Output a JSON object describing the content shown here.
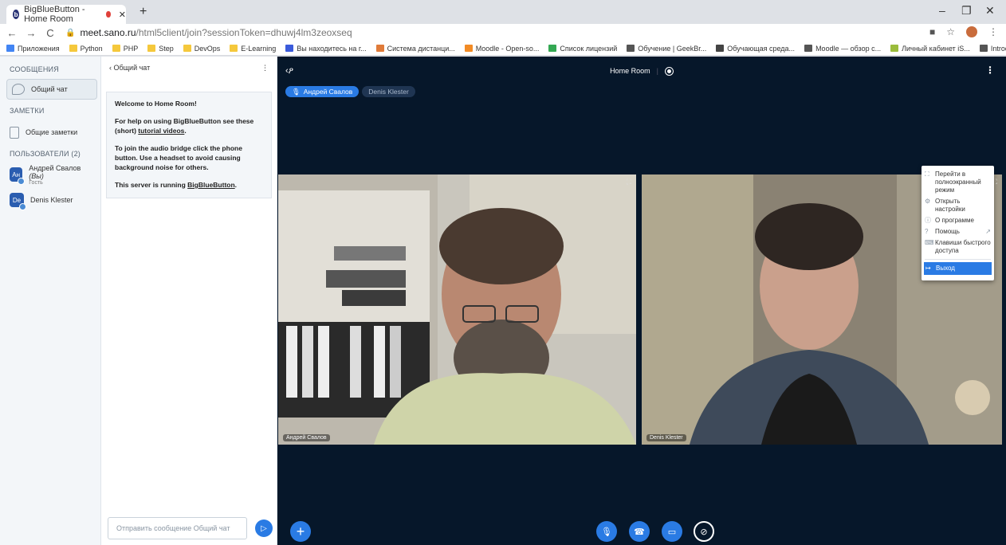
{
  "browser": {
    "tab_title": "BigBlueButton - Home Room",
    "url_host": "meet.sano.ru",
    "url_path": "/html5client/join?sessionToken=dhuwj4lm3zeoxseq",
    "bookmarks": [
      {
        "label": "Приложения",
        "color": "#4285f4"
      },
      {
        "label": "Python",
        "color": "#f5c83c"
      },
      {
        "label": "PHP",
        "color": "#f5c83c"
      },
      {
        "label": "Step",
        "color": "#f5c83c"
      },
      {
        "label": "DevOps",
        "color": "#f5c83c"
      },
      {
        "label": "E-Learning",
        "color": "#f5c83c"
      },
      {
        "label": "Вы находитесь на г...",
        "color": "#3b5bdb"
      },
      {
        "label": "Система дистанци...",
        "color": "#e07b39"
      },
      {
        "label": "Moodle - Open-so...",
        "color": "#f28b25"
      },
      {
        "label": "Список лицензий",
        "color": "#34a853"
      },
      {
        "label": "Обучение | GeekBr...",
        "color": "#555555"
      },
      {
        "label": "Обучающая среда...",
        "color": "#444444"
      },
      {
        "label": "Moodle — обзор с...",
        "color": "#555555"
      },
      {
        "label": "Личный кабинет iS...",
        "color": "#9bbc3c"
      },
      {
        "label": "Introduction to Pac...",
        "color": "#555555"
      }
    ]
  },
  "sidebar": {
    "messages_title": "СООБЩЕНИЯ",
    "public_chat": "Общий чат",
    "notes_title": "ЗАМЕТКИ",
    "shared_notes": "Общие заметки",
    "users_title": "ПОЛЬЗОВАТЕЛИ (2)",
    "users": [
      {
        "initials": "Ан",
        "name": "Андрей Свалов",
        "you": "(Вы)",
        "role": "Гость"
      },
      {
        "initials": "De",
        "name": "Denis Klester",
        "you": "",
        "role": ""
      }
    ]
  },
  "chat": {
    "header": "Общий чат",
    "welcome_title": "Welcome to Home Room!",
    "help_pre": "For help on using BigBlueButton see these (short) ",
    "help_link": "tutorial videos",
    "help_post": ".",
    "audio_text": "To join the audio bridge click the phone button. Use a headset to avoid causing background noise for others.",
    "server_pre": "This server is running ",
    "server_link": "BigBlueButton",
    "server_post": ".",
    "input_placeholder": "Отправить сообщение Общий чат"
  },
  "stage": {
    "room_title": "Home Room",
    "talkers": [
      {
        "name": "Андрей Свалов",
        "active": true
      },
      {
        "name": "Denis Klester",
        "active": false
      }
    ],
    "videos": [
      {
        "name": "Андрей Свалов"
      },
      {
        "name": "Denis Klester"
      }
    ]
  },
  "menu": {
    "fullscreen": "Перейти в полноэкранный режим",
    "settings": "Открыть настройки",
    "about": "О программе",
    "help": "Помощь",
    "shortcuts": "Клавиши быстрого доступа",
    "logout": "Выход"
  }
}
